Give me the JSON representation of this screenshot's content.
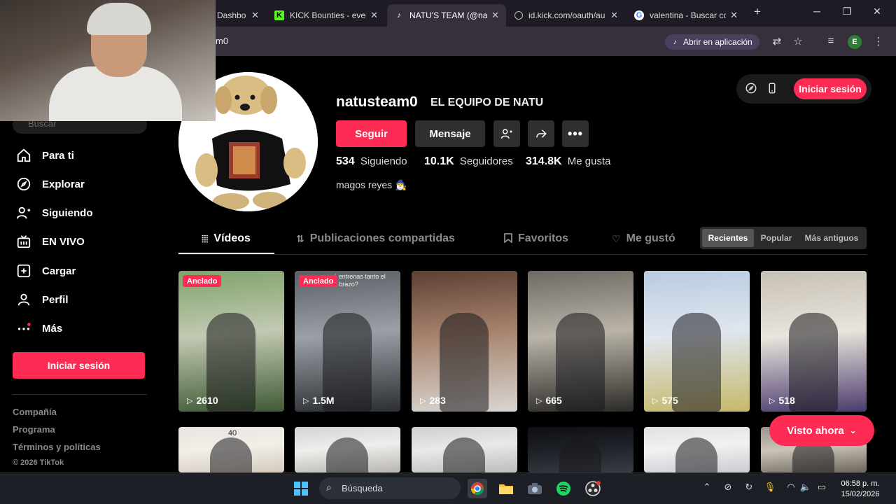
{
  "browser": {
    "tabs": [
      {
        "title": "Dashbo",
        "favicon": "dashboard-icon"
      },
      {
        "title": "KICK Bounties - every",
        "favicon": "kick-icon"
      },
      {
        "title": "NATU'S TEAM (@natu",
        "favicon": "tiktok-icon",
        "active": true
      },
      {
        "title": "id.kick.com/oauth/au",
        "favicon": "globe-icon"
      },
      {
        "title": "valentina - Buscar co",
        "favicon": "google-icon"
      }
    ],
    "close_glyph": "✕",
    "new_tab_glyph": "+",
    "url": "m0",
    "open_app_label": "Abrir en aplicación",
    "profile_initial": "E"
  },
  "sidebar": {
    "search_placeholder": "Buscar",
    "nav": [
      {
        "label": "Para ti",
        "icon": "home-icon"
      },
      {
        "label": "Explorar",
        "icon": "compass-icon"
      },
      {
        "label": "Siguiendo",
        "icon": "following-icon"
      },
      {
        "label": "EN VIVO",
        "icon": "live-icon"
      },
      {
        "label": "Cargar",
        "icon": "upload-icon"
      },
      {
        "label": "Perfil",
        "icon": "profile-icon"
      },
      {
        "label": "Más",
        "icon": "more-dots-icon"
      }
    ],
    "login_label": "Iniciar sesión",
    "footer": [
      "Compañía",
      "Programa",
      "Términos y políticas"
    ],
    "copyright": "© 2026 TikTok"
  },
  "profile": {
    "username": "natusteam0",
    "nickname": "EL EQUIPO DE NATU",
    "follow_label": "Seguir",
    "message_label": "Mensaje",
    "stats": {
      "following_count": "534",
      "following_label": "Siguiendo",
      "followers_count": "10.1K",
      "followers_label": "Seguidores",
      "likes_count": "314.8K",
      "likes_label": "Me gusta"
    },
    "bio": "magos reyes 🧙‍♂️"
  },
  "header": {
    "login_label": "Iniciar sesión"
  },
  "tabs": [
    {
      "label": "Vídeos",
      "icon": "grid-icon",
      "active": true
    },
    {
      "label": "Publicaciones compartidas",
      "icon": "repost-icon"
    },
    {
      "label": "Favoritos",
      "icon": "bookmark-icon"
    },
    {
      "label": "Me gustó",
      "icon": "liked-icon"
    }
  ],
  "sort": [
    "Recientes",
    "Popular",
    "Más antiguos"
  ],
  "videos": [
    {
      "views": "2610",
      "pinned": true,
      "colors": [
        "#7fa36b",
        "#c2c9b2",
        "#3f5a35"
      ]
    },
    {
      "views": "1.5M",
      "pinned": true,
      "colors": [
        "#5a5f66",
        "#9aa0a6",
        "#2b2e33"
      ],
      "caption": "¿por qué entrenas tanto el brazo?"
    },
    {
      "views": "283",
      "colors": [
        "#5c4034",
        "#a7836d",
        "#d9d6d1"
      ]
    },
    {
      "views": "665",
      "colors": [
        "#6e6a63",
        "#b9b3a8",
        "#2c2a27"
      ]
    },
    {
      "views": "575",
      "colors": [
        "#b9cbe0",
        "#dfe6ee",
        "#c6b86a"
      ]
    },
    {
      "views": "518",
      "colors": [
        "#c6c0b5",
        "#e9e4dc",
        "#4b3b6e"
      ]
    },
    {
      "colors": [
        "#e8e4de",
        "#f2efe9",
        "#d4cabd"
      ],
      "caption": "40"
    },
    {
      "colors": [
        "#d3d3d1",
        "#eeeeec",
        "#b8b5af"
      ]
    },
    {
      "colors": [
        "#cfcfcf",
        "#e9e9e9",
        "#bcbcbc"
      ]
    },
    {
      "colors": [
        "#0e0f12",
        "#1d2027",
        "#3a3c44"
      ]
    },
    {
      "colors": [
        "#e1e1e3",
        "#f1f1f2",
        "#caccd0"
      ]
    },
    {
      "colors": [
        "#9a948a",
        "#c9c3b8",
        "#6b655c"
      ]
    }
  ],
  "pinned_label": "Anclado",
  "visto_label": "Visto ahora",
  "taskbar": {
    "search_label": "Búsqueda",
    "time": "06:58 p. m.",
    "date": "15/02/2026"
  },
  "colors": {
    "accent": "#fe2c55",
    "background": "#000000"
  }
}
